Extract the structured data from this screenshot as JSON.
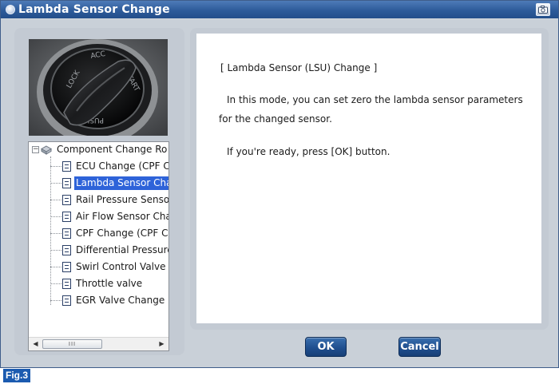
{
  "window": {
    "title": "Lambda Sensor Change",
    "title_icon": "lambda-gear-icon",
    "camera_icon": "camera-icon"
  },
  "tree": {
    "root_label": "Component Change Ro",
    "root_icon": "component-folder-icon",
    "items": [
      {
        "label": "ECU Change (CPF C",
        "selected": false
      },
      {
        "label": "Lambda Sensor Cha",
        "selected": true
      },
      {
        "label": "Rail Pressure Senso",
        "selected": false
      },
      {
        "label": "Air Flow Sensor Cha",
        "selected": false
      },
      {
        "label": "CPF Change (CPF C",
        "selected": false
      },
      {
        "label": "Differential Pressure",
        "selected": false
      },
      {
        "label": "Swirl Control Valve C",
        "selected": false
      },
      {
        "label": "Throttle valve",
        "selected": false
      },
      {
        "label": "EGR Valve Change",
        "selected": false
      }
    ],
    "scrollbar_thumb_grip": "III"
  },
  "content": {
    "heading": "[ Lambda Sensor (LSU) Change ]",
    "line1": "In this mode, you can set zero the lambda sensor parameters",
    "line2": "for the changed sensor.",
    "line3": "If you're ready, press [OK] button."
  },
  "buttons": {
    "ok": "OK",
    "cancel": "Cancel"
  },
  "figure_label": "Fig.3",
  "colors": {
    "titlebar": "#2d5b9a",
    "selection": "#2e63d9",
    "button": "#1f4f8f",
    "panel": "#c3cad3"
  }
}
